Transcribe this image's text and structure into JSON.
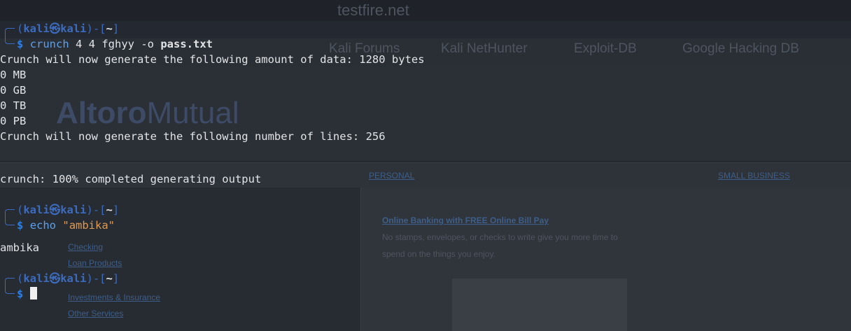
{
  "browser": {
    "url": "testfire.net",
    "bookmarks": [
      "Kali Forums",
      "Kali NetHunter",
      "Exploit-DB",
      "Google Hacking DB"
    ]
  },
  "site": {
    "logo_bold": "Altoro",
    "logo_light": "Mutual",
    "tabs": [
      "PERSONAL",
      "SMALL BUSINESS"
    ],
    "sidebar_items": [
      "Checking",
      "Loan Products",
      "Investments & Insurance",
      "Other Services"
    ],
    "promo_title": "Online Banking with FREE Online Bill Pay",
    "promo_line1": "No stamps, envelopes, or checks to write give you more time to",
    "promo_line2": "spend on the things you enjoy."
  },
  "terminal": {
    "prompt": {
      "user": "kali",
      "at_symbol": "㉿",
      "host": "kali",
      "dir": "~",
      "dollar": "$"
    },
    "cmd1": {
      "program": "crunch",
      "args": " 4 4 fghyy -o ",
      "file": "pass.txt"
    },
    "output1": [
      "Crunch will now generate the following amount of data: 1280 bytes",
      "0 MB",
      "0 GB",
      "0 TB",
      "0 PB",
      "Crunch will now generate the following number of lines: 256"
    ],
    "output2": "crunch: 100% completed generating output",
    "cmd2": {
      "program": "echo",
      "string": "\"ambika\""
    },
    "output3": "ambika"
  }
}
